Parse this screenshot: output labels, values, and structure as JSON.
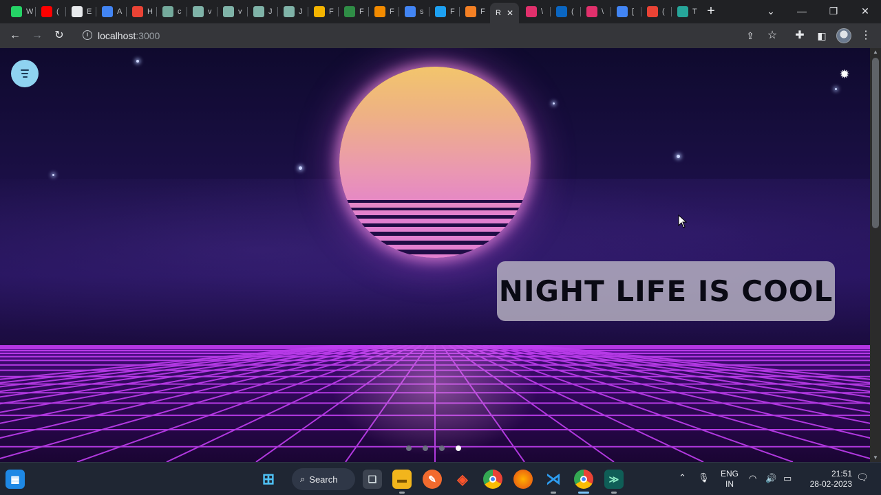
{
  "browser": {
    "tabs": [
      {
        "label": "W",
        "icon": "whatsapp-icon",
        "color": "#25d366"
      },
      {
        "label": "(",
        "icon": "youtube-icon",
        "color": "#ff0000"
      },
      {
        "label": "E",
        "icon": "document-icon",
        "color": "#e8eaed"
      },
      {
        "label": "A",
        "icon": "docs-icon",
        "color": "#4285f4"
      },
      {
        "label": "H",
        "icon": "swirl-icon",
        "color": "#ea4335"
      },
      {
        "label": "c",
        "icon": "chatgpt-icon",
        "color": "#74aa9c"
      },
      {
        "label": "v",
        "icon": "mountain-icon",
        "color": "#7fb3a8"
      },
      {
        "label": "v",
        "icon": "mountain-icon",
        "color": "#7fb3a8"
      },
      {
        "label": "J",
        "icon": "mountain-icon",
        "color": "#7fb3a8"
      },
      {
        "label": "J",
        "icon": "mountain-icon",
        "color": "#7fb3a8"
      },
      {
        "label": "F",
        "icon": "layers-icon",
        "color": "#f4b400"
      },
      {
        "label": "F",
        "icon": "gfg-icon",
        "color": "#2f8d46"
      },
      {
        "label": "F",
        "icon": "cc-icon",
        "color": "#f28b00"
      },
      {
        "label": "s",
        "icon": "google-icon",
        "color": "#4285f4"
      },
      {
        "label": "F",
        "icon": "twitter-icon",
        "color": "#1da1f2"
      },
      {
        "label": "F",
        "icon": "stackoverflow-icon",
        "color": "#f48024"
      },
      {
        "label": "R",
        "icon": "react-icon",
        "color": "#e8eaed",
        "active": true
      },
      {
        "label": "\\",
        "icon": "instagram-icon",
        "color": "#e1306c"
      },
      {
        "label": "(",
        "icon": "linkedin-icon",
        "color": "#0a66c2"
      },
      {
        "label": "\\",
        "icon": "instagram-icon",
        "color": "#e1306c"
      },
      {
        "label": "[",
        "icon": "download-icon",
        "color": "#4285f4"
      },
      {
        "label": "(",
        "icon": "refresh-icon",
        "color": "#ea4335"
      },
      {
        "label": "T",
        "icon": "terminal-icon",
        "color": "#26a69a"
      }
    ],
    "url_host": "localhost",
    "url_port": ":3000"
  },
  "page": {
    "caption": "NIGHT LIFE IS COOL",
    "slides_total": 4,
    "active_slide": 4
  },
  "taskbar": {
    "search_label": "Search",
    "lang_top": "ENG",
    "lang_bottom": "IN",
    "time": "21:51",
    "date": "28-02-2023"
  }
}
